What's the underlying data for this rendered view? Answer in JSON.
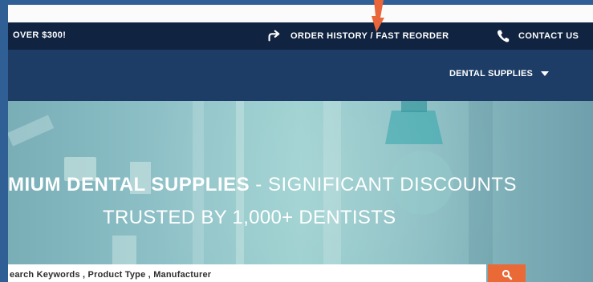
{
  "topbar": {
    "promo": "OVER $300!",
    "order_history": "ORDER HISTORY / FAST REORDER",
    "contact": "CONTACT US"
  },
  "nav": {
    "menu_label": "DENTAL SUPPLIES"
  },
  "hero": {
    "headline_strong": "MIUM DENTAL SUPPLIES",
    "headline_rest": " - SIGNIFICANT DISCOUNTS",
    "subheadline": "TRUSTED BY 1,000+ DENTISTS"
  },
  "search": {
    "placeholder": "earch Keywords , Product Type , Manufacturer"
  },
  "colors": {
    "topbar": "#102340",
    "nav": "#1d3d66",
    "accent": "#ea6a37",
    "page_bg": "#2f5f95"
  }
}
